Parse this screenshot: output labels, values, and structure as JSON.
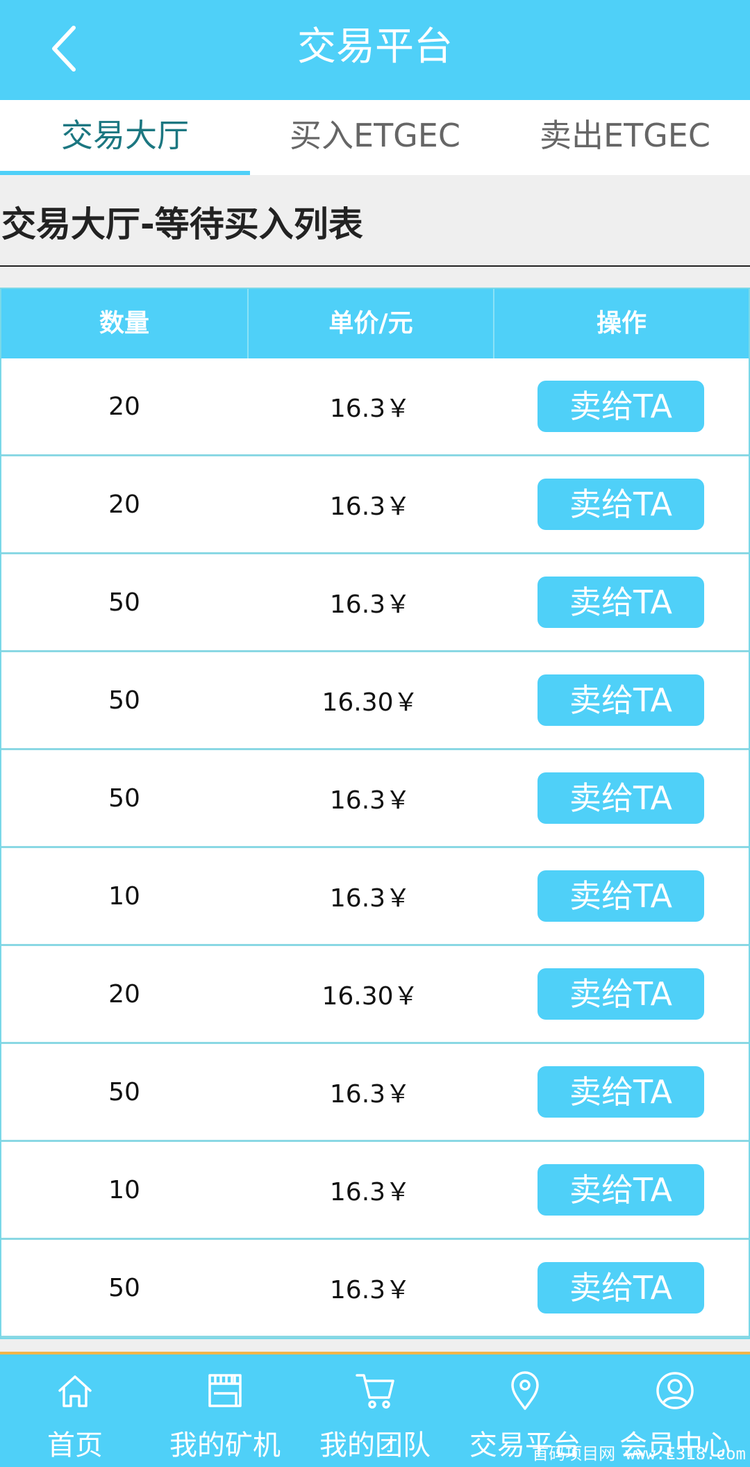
{
  "header": {
    "title": "交易平台"
  },
  "tabs": [
    {
      "label": "交易大厅",
      "active": true
    },
    {
      "label": "买入ETGEC",
      "active": false
    },
    {
      "label": "卖出ETGEC",
      "active": false
    }
  ],
  "section": {
    "title": "交易大厅-等待买入列表"
  },
  "table": {
    "headers": [
      "数量",
      "单价/元",
      "操作"
    ],
    "rows": [
      {
        "qty": "20",
        "price": "16.3￥",
        "action": "卖给TA"
      },
      {
        "qty": "20",
        "price": "16.3￥",
        "action": "卖给TA"
      },
      {
        "qty": "50",
        "price": "16.3￥",
        "action": "卖给TA"
      },
      {
        "qty": "50",
        "price": "16.30￥",
        "action": "卖给TA"
      },
      {
        "qty": "50",
        "price": "16.3￥",
        "action": "卖给TA"
      },
      {
        "qty": "10",
        "price": "16.3￥",
        "action": "卖给TA"
      },
      {
        "qty": "20",
        "price": "16.30￥",
        "action": "卖给TA"
      },
      {
        "qty": "50",
        "price": "16.3￥",
        "action": "卖给TA"
      },
      {
        "qty": "10",
        "price": "16.3￥",
        "action": "卖给TA"
      },
      {
        "qty": "50",
        "price": "16.3￥",
        "action": "卖给TA"
      }
    ]
  },
  "footer": {
    "items": [
      {
        "label": "首页",
        "icon": "home-icon"
      },
      {
        "label": "我的矿机",
        "icon": "store-icon"
      },
      {
        "label": "我的团队",
        "icon": "cart-icon"
      },
      {
        "label": "交易平台",
        "icon": "location-icon"
      },
      {
        "label": "会员中心",
        "icon": "user-icon"
      }
    ],
    "watermark": "首码项目网 www.E318.com"
  },
  "colors": {
    "accent": "#4fd0f8",
    "active_tab_text": "#1c7781",
    "footer_border": "#f2b54a"
  }
}
